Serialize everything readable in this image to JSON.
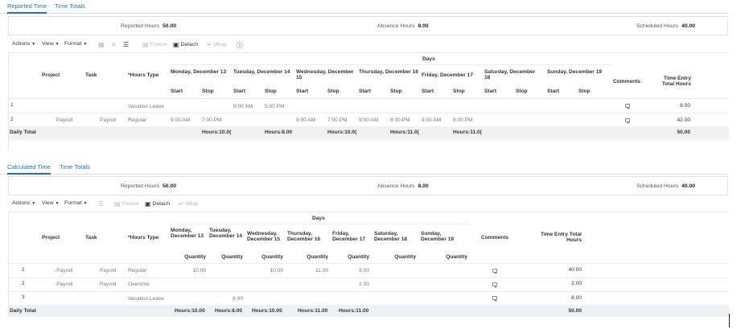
{
  "top": {
    "tabs": [
      "Reported Time",
      "Time Totals"
    ],
    "summary": {
      "reported_label": "Reported Hours",
      "reported_value": "50.00",
      "absence_label": "Absence Hours",
      "absence_value": "8.00",
      "scheduled_label": "Scheduled Hours",
      "scheduled_value": "40.00"
    },
    "toolbar": {
      "actions": "Actions",
      "view": "View",
      "format": "Format",
      "freeze": "Freeze",
      "detach": "Detach",
      "wrap": "Wrap"
    },
    "days_header": "Days",
    "columns": {
      "project": "Project",
      "task": "Task",
      "hours_type": "*Hours Type",
      "comments": "Comments",
      "total": "Time Entry Total Hours",
      "start": "Start",
      "stop": "Stop"
    },
    "days": [
      "Monday, December 13",
      "Tuesday, December 14",
      "Wednesday, December 15",
      "Thursday, December 16",
      "Friday, December 17",
      "Saturday, December 18",
      "Sunday, December 19"
    ],
    "rows": [
      {
        "num": "1",
        "project": "",
        "task": "",
        "type": "Vacation Leave",
        "times": [
          "",
          "",
          "9:00 AM",
          "5:00 PM",
          "",
          "",
          "",
          "",
          "",
          "",
          "",
          "",
          "",
          ""
        ],
        "total": "8.00"
      },
      {
        "num": "2",
        "project": "Payroll",
        "task": "Payroll",
        "type": "Regular",
        "times": [
          "9:00 AM",
          "7:00 PM",
          "",
          "",
          "9:00 AM",
          "7:00 PM",
          "9:00 AM",
          "8:00 PM",
          "9:00 AM",
          "8:00 PM",
          "",
          "",
          "",
          ""
        ],
        "total": "42.00"
      }
    ],
    "daily": {
      "label": "Daily Total",
      "values": [
        "Hours:10.0(",
        "Hours:8.00",
        "Hours:10.0(",
        "Hours:11.0(",
        "Hours:11.0("
      ],
      "total": "50.00"
    }
  },
  "bottom": {
    "tabs": [
      "Calculated Time",
      "Time Totals"
    ],
    "summary": {
      "reported_label": "Reported Hours",
      "reported_value": "50.00",
      "absence_label": "Absence Hours",
      "absence_value": "8.00",
      "scheduled_label": "Scheduled Hours",
      "scheduled_value": "40.00"
    },
    "toolbar": {
      "actions": "Actions",
      "view": "View",
      "format": "Format",
      "freeze": "Freeze",
      "detach": "Detach",
      "wrap": "Wrap"
    },
    "days_header": "Days",
    "columns": {
      "project": "Project",
      "task": "Task",
      "hours_type": "*Hours Type",
      "comments": "Comments",
      "total": "Time Entry Total Hours",
      "quantity": "Quantity"
    },
    "days": [
      "Monday, December 13",
      "Tuesday, December 14",
      "Wednesday, December 15",
      "Thursday, December 16",
      "Friday, December 17",
      "Saturday, December 18",
      "Sunday, December 19"
    ],
    "rows": [
      {
        "num": "1",
        "project": "-Payroll",
        "task": "Payroll",
        "type": "Regular",
        "qty": [
          "10.00",
          "",
          "10.00",
          "11.00",
          "9.00",
          "",
          ""
        ],
        "total": "40.00"
      },
      {
        "num": "2",
        "project": "-Payroll",
        "task": "Payroll",
        "type": "Overtime",
        "qty": [
          "",
          "",
          "",
          "",
          "2.00",
          "",
          ""
        ],
        "total": "2.00"
      },
      {
        "num": "3",
        "project": "",
        "task": "",
        "type": "Vacation Leave",
        "qty": [
          "",
          "8.00",
          "",
          "",
          "",
          "",
          ""
        ],
        "total": "8.00"
      }
    ],
    "daily": {
      "label": "Daily Total",
      "values": [
        "Hours:10.00",
        "Hours:8.00",
        "Hours:10.00",
        "Hours:11.00",
        "Hours:11.00"
      ],
      "total": "50.00"
    }
  }
}
